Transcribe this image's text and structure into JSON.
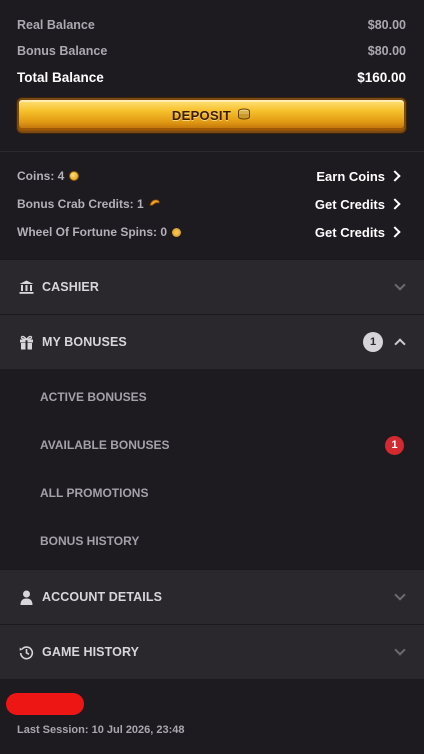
{
  "balances": {
    "real_label": "Real Balance",
    "real_value": "$80.00",
    "bonus_label": "Bonus Balance",
    "bonus_value": "$80.00",
    "total_label": "Total Balance",
    "total_value": "$160.00"
  },
  "deposit": {
    "label": "DEPOSIT",
    "icon": "coins-icon"
  },
  "credits": [
    {
      "label": "Coins: 4",
      "icon": "coin-icon",
      "action": "Earn Coins"
    },
    {
      "label": "Bonus Crab Credits: 1",
      "icon": "crab-credit-icon",
      "action": "Get Credits"
    },
    {
      "label": "Wheel Of Fortune Spins: 0",
      "icon": "wheel-icon",
      "action": "Get Credits"
    }
  ],
  "sections": {
    "cashier": {
      "title": "CASHIER",
      "icon": "bank-icon"
    },
    "bonuses": {
      "title": "MY BONUSES",
      "icon": "gift-icon",
      "count": "1",
      "items": [
        {
          "label": "ACTIVE BONUSES"
        },
        {
          "label": "AVAILABLE BONUSES",
          "badge": "1"
        },
        {
          "label": "ALL PROMOTIONS"
        },
        {
          "label": "BONUS HISTORY"
        }
      ]
    },
    "account": {
      "title": "ACCOUNT DETAILS",
      "icon": "user-icon"
    },
    "history": {
      "title": "GAME HISTORY",
      "icon": "history-icon"
    }
  },
  "footer": {
    "last_session": "Last Session: 10 Jul 2026, 23:48"
  },
  "colors": {
    "background": "#1d1a20",
    "section": "#2a272d",
    "gold": "#f6c12b",
    "badge_red": "#d22a30",
    "redaction": "#ee1515"
  }
}
